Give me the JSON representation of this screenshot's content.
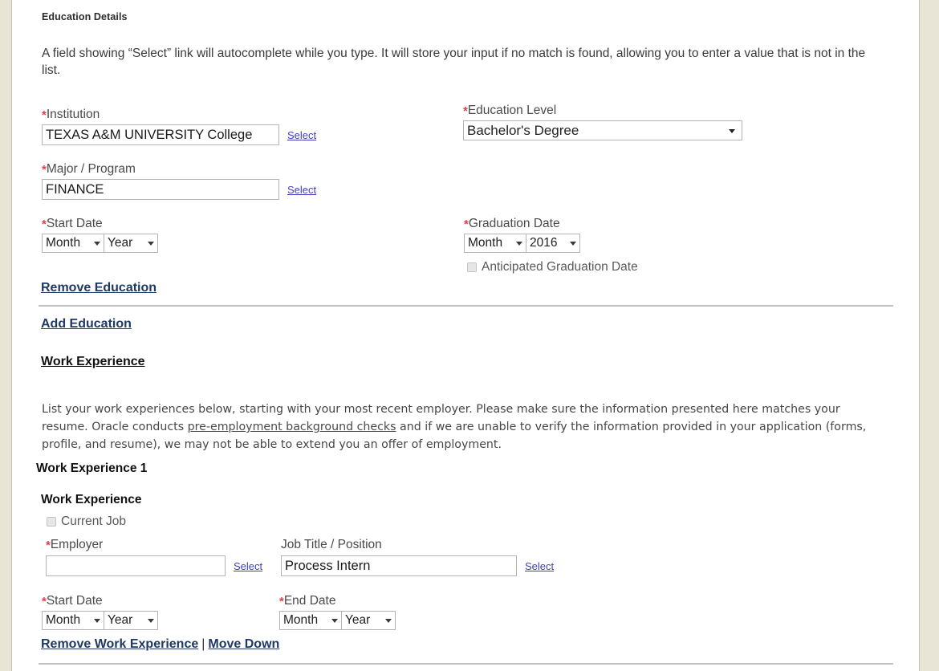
{
  "section": {
    "title": "Education Details",
    "intro": "A field showing “Select” link will autocomplete while you type. It will store your input if no match is found, allowing you to enter a value that is not in the list."
  },
  "education": {
    "institution": {
      "label": "Institution",
      "required": "*",
      "value": "TEXAS A&M UNIVERSITY College",
      "select_link": "Select"
    },
    "education_level": {
      "label": "Education Level",
      "required": "*",
      "value": "Bachelor's Degree"
    },
    "major": {
      "label": "Major / Program",
      "required": "*",
      "value": "FINANCE",
      "select_link": "Select"
    },
    "start_date": {
      "label": "Start Date",
      "required": "*",
      "month": "Month",
      "year": "Year"
    },
    "graduation_date": {
      "label": "Graduation Date",
      "required": "*",
      "month": "Month",
      "year": "2016"
    },
    "anticipated_checkbox": {
      "label": "Anticipated Graduation Date",
      "checked": false
    },
    "remove_link": "Remove Education",
    "add_link": "Add Education"
  },
  "work_experience": {
    "heading": "Work Experience",
    "description_part1": "List your work experiences below, starting with your most recent employer. Please make sure the information presented here matches your resume. Oracle conducts ",
    "description_link": "pre-employment background checks",
    "description_part2": " and if we are unable to verify the information provided in your application (forms, profile, and resume), we may not be able to extend you an offer of employment.",
    "entry_title": "Work Experience 1",
    "entry_subtitle": "Work Experience",
    "current_job": {
      "label": "Current Job",
      "checked": false
    },
    "employer": {
      "label": "Employer",
      "required": "*",
      "value": "",
      "select_link": "Select"
    },
    "job_title": {
      "label": "Job Title / Position",
      "required": "",
      "value": "Process Intern",
      "select_link": "Select"
    },
    "start_date": {
      "label": "Start Date",
      "required": "*",
      "month": "Month",
      "year": "Year"
    },
    "end_date": {
      "label": "End Date",
      "required": "*",
      "month": "Month",
      "year": "Year"
    },
    "remove_link": "Remove Work Experience",
    "separator": "|",
    "move_down_link": "Move Down"
  },
  "colors": {
    "link": "#1f3864",
    "select_link": "#3e3fbf",
    "required": "#e0404a",
    "page_bg": "#e8e5d6",
    "panel_bg": "#ffffff"
  }
}
